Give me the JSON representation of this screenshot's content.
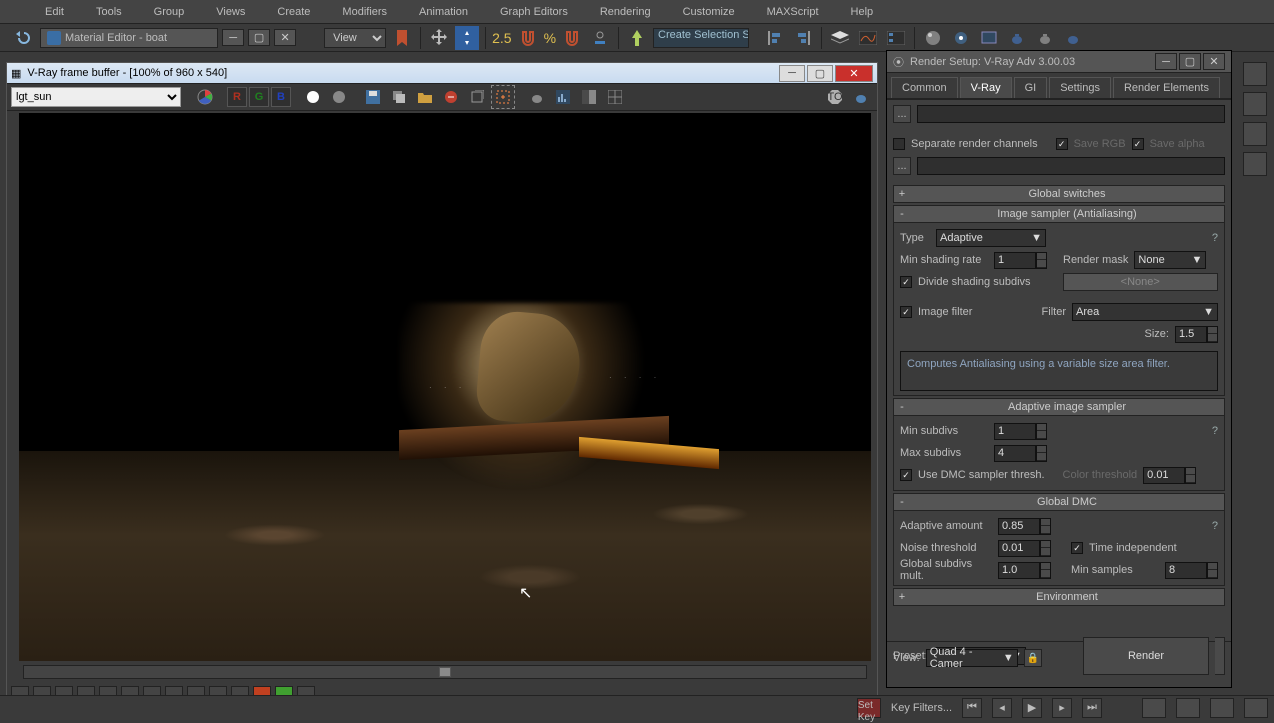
{
  "menu": [
    "Edit",
    "Tools",
    "Group",
    "Views",
    "Create",
    "Modifiers",
    "Animation",
    "Graph Editors",
    "Rendering",
    "Customize",
    "MAXScript",
    "Help"
  ],
  "material_editor_tab": "Material Editor - boat",
  "view_dropdown": "View",
  "selection_set": "Create Selection Se",
  "toolbar_big_numbers": [
    "2.5",
    "%"
  ],
  "vfb": {
    "title": "V-Ray frame buffer - [100% of 960 x 540]",
    "channel": "lgt_sun",
    "rgb_buttons": [
      "R",
      "G",
      "B"
    ]
  },
  "render_setup": {
    "title": "Render Setup: V-Ray Adv 3.00.03",
    "tabs": [
      "Common",
      "V-Ray",
      "GI",
      "Settings",
      "Render Elements"
    ],
    "active_tab": "V-Ray",
    "separate_channels": "Separate render channels",
    "save_rgb": "Save RGB",
    "save_alpha": "Save alpha",
    "rollouts": {
      "global_switches": "Global switches",
      "image_sampler": "Image sampler (Antialiasing)",
      "adaptive": "Adaptive image sampler",
      "global_dmc": "Global DMC",
      "environment": "Environment"
    },
    "sampler": {
      "type_label": "Type",
      "type_value": "Adaptive",
      "min_shading_label": "Min shading rate",
      "min_shading_value": "1",
      "render_mask_label": "Render mask",
      "render_mask_value": "None",
      "divide_label": "Divide shading subdivs",
      "none_btn": "<None>",
      "image_filter_label": "Image filter",
      "filter_label": "Filter",
      "filter_value": "Area",
      "size_label": "Size:",
      "size_value": "1.5",
      "desc": "Computes Antialiasing using a variable size area filter."
    },
    "adaptive": {
      "min_label": "Min subdivs",
      "min_value": "1",
      "max_label": "Max subdivs",
      "max_value": "4",
      "dmc_label": "Use DMC sampler thresh.",
      "color_thr_label": "Color threshold",
      "color_thr_value": "0.01"
    },
    "dmc": {
      "adaptive_amount_label": "Adaptive amount",
      "adaptive_amount_value": "0.85",
      "noise_thr_label": "Noise threshold",
      "noise_thr_value": "0.01",
      "time_independent": "Time independent",
      "global_subdivs_label": "Global subdivs mult.",
      "global_subdivs_value": "1.0",
      "min_samples_label": "Min samples",
      "min_samples_value": "8"
    },
    "footer": {
      "preset_label": "Preset:",
      "preset_value": "-------------------",
      "view_label": "View:",
      "view_value": "Quad 4 - Camer",
      "render": "Render"
    }
  },
  "status": {
    "set_key": "Set Key",
    "key_filters": "Key Filters..."
  }
}
